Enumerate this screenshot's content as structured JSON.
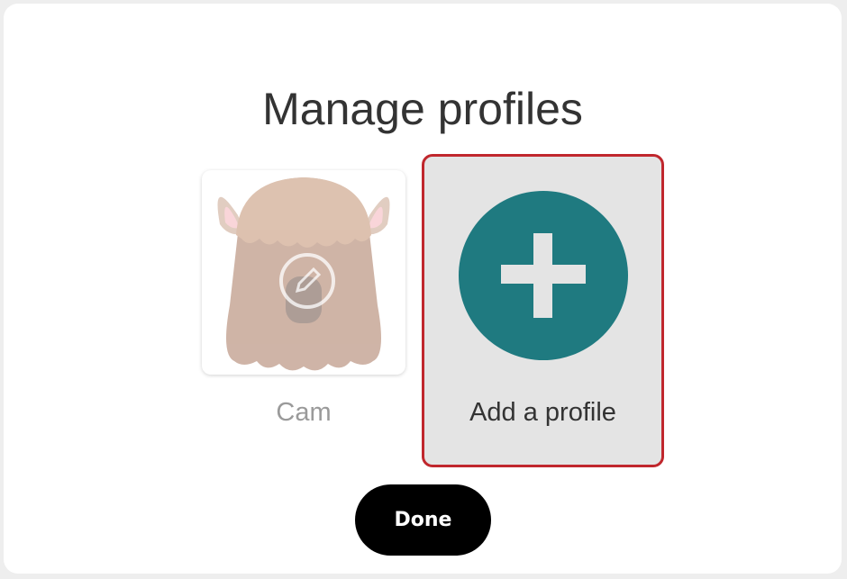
{
  "dialog": {
    "title": "Manage profiles"
  },
  "profiles": [
    {
      "name": "Cam",
      "avatar": "llama-avatar",
      "overlay_icon": "edit-pencil-icon"
    }
  ],
  "add_profile": {
    "label": "Add a profile",
    "icon": "plus-icon",
    "accent_color": "#1f7a80",
    "selected_border_color": "#c0272d"
  },
  "done_button": {
    "label": "Done"
  }
}
